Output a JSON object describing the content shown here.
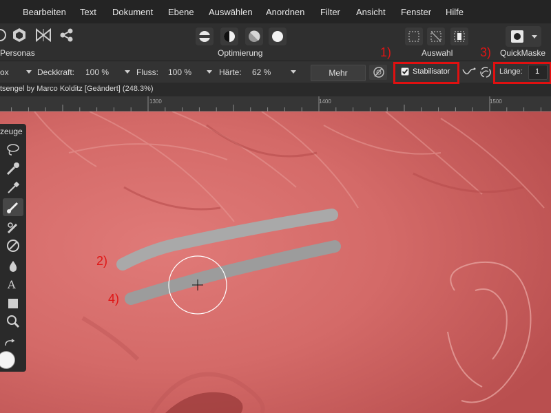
{
  "menu": [
    "Bearbeiten",
    "Text",
    "Dokument",
    "Ebene",
    "Auswählen",
    "Anordnen",
    "Filter",
    "Ansicht",
    "Fenster",
    "Hilfe"
  ],
  "toolbar": {
    "personas_label": "Personas",
    "optimierung_label": "Optimierung",
    "auswahl_label": "Auswahl",
    "quickmaske_label": "QuickMaske"
  },
  "context": {
    "brush_value": "ox",
    "deckkraft_label": "Deckkraft:",
    "deckkraft_value": "100 %",
    "fluss_label": "Fluss:",
    "fluss_value": "100 %",
    "haerte_label": "Härte:",
    "haerte_value": "62 %",
    "mehr_label": "Mehr",
    "stabilisator_label": "Stabilisator",
    "stabilisator_checked": true,
    "laenge_label": "Länge:",
    "laenge_value": "1"
  },
  "document": {
    "title": "tsengel by Marco Kolditz [Geändert] (248.3%)"
  },
  "ruler": {
    "ticks": [
      "1300",
      "1400",
      "1500"
    ]
  },
  "tools_panel": {
    "title": "zeuge"
  },
  "annotations": {
    "a1": "1)",
    "a2": "2)",
    "a3": "3)",
    "a4": "4)"
  },
  "colors": {
    "mask_overlay": "#d96060",
    "annotation_red": "#e01515",
    "stroke_gray": "#a9a9a9"
  }
}
